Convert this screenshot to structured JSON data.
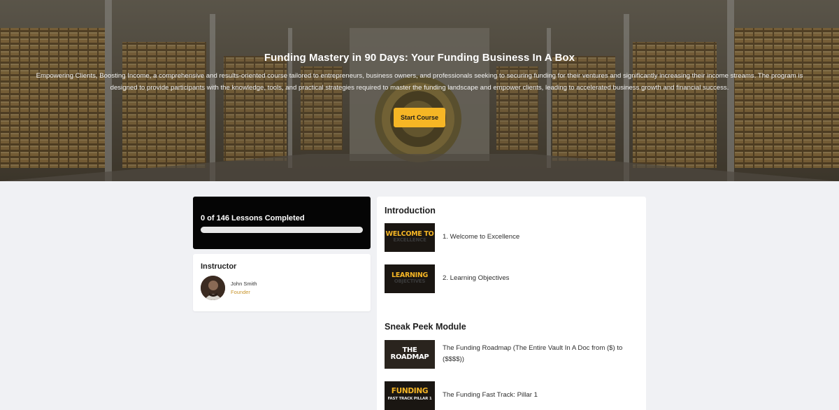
{
  "hero": {
    "title": "Funding Mastery in 90 Days: Your Funding Business In A Box",
    "description": "Empowering Clients, Boosting Income, a comprehensive and results-oriented course tailored to entrepreneurs, business owners, and professionals seeking to securing funding for their ventures and significantly increasing their income streams. The program is designed to provide participants with the knowledge, tools, and practical strategies required to master the funding landscape and empower clients, leading to accelerated business growth and financial success.",
    "start_button": "Start Course"
  },
  "progress": {
    "label": "0 of 146 Lessons Completed",
    "completed": 0,
    "total": 146,
    "fraction": 0
  },
  "instructor": {
    "heading": "Instructor",
    "name": "John Smith",
    "role": "Founder"
  },
  "modules": [
    {
      "title": "Introduction",
      "lessons": [
        {
          "label": "1. Welcome to Excellence",
          "thumb_line1": "WELCOME TO",
          "thumb_line2": "EXCELLENCE"
        },
        {
          "label": "2. Learning Objectives",
          "thumb_line1": "LEARNING",
          "thumb_line2": "OBJECTIVES"
        }
      ]
    },
    {
      "title": "Sneak Peek Module",
      "lessons": [
        {
          "label": "The Funding Roadmap (The Entire Vault In A Doc from ($) to ($$$$))",
          "thumb_line1": "THE",
          "thumb_line2": "ROADMAP"
        },
        {
          "label": "The Funding Fast Track: Pillar 1",
          "thumb_line1": "FUNDING",
          "thumb_line2": "FAST TRACK PILLAR 1"
        }
      ]
    }
  ],
  "colors": {
    "accent": "#f6b625",
    "progress_card_bg": "#050505",
    "page_bg": "#f0f1f4",
    "role_text": "#c9962e"
  }
}
